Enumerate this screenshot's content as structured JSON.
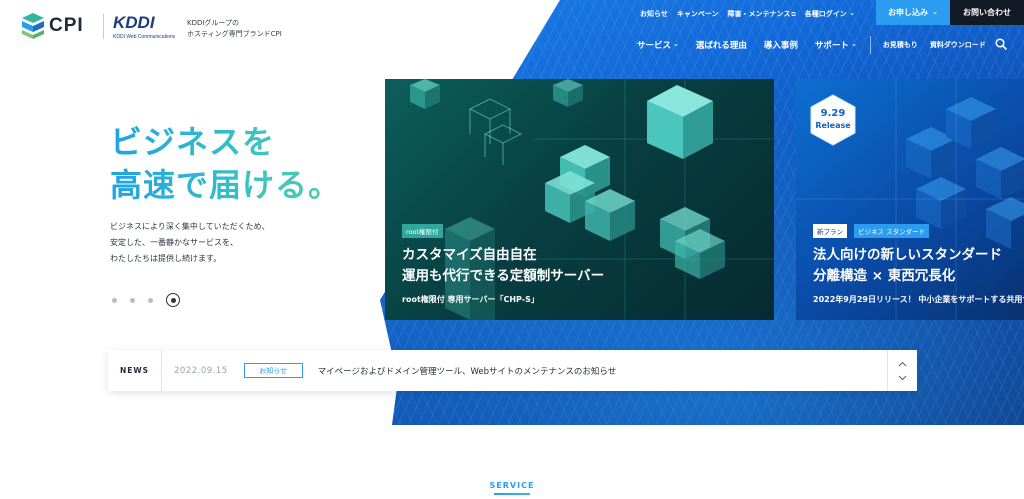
{
  "brand": {
    "cpi_name": "CPI",
    "kddi_name": "KDDI",
    "kddi_sub": "KDDI Web Communications",
    "tagline": [
      "KDDIグループの",
      "ホスティング専門ブランドCPI"
    ]
  },
  "header": {
    "top_links": [
      "お知らせ",
      "キャンペーン",
      "障害・メンテナンス",
      "各種ログイン"
    ],
    "apply_label": "お申し込み",
    "contact_label": "お問い合わせ",
    "main_nav": [
      "サービス",
      "選ばれる理由",
      "導入事例",
      "サポート"
    ],
    "sub_nav": [
      "お見積もり",
      "資料ダウンロード"
    ]
  },
  "hero": {
    "title_line1": "ビジネスを",
    "title_line2": "高速で届ける。",
    "desc_line1": "ビジネスにより深く集中していただくため、",
    "desc_line2": "安定した、一番静かなサービスを、",
    "desc_line3": "わたしたちは提供し続けます。",
    "slide_count": 4,
    "active_slide": 4
  },
  "slides": [
    {
      "tag": "root権限付",
      "title_line1": "カスタマイズ自由自在",
      "title_line2": "運用も代行できる定額制サーバー",
      "subtitle": "root権限付 専用サーバー「CHP-S」"
    },
    {
      "badge_date": "9.29",
      "badge_release": "Release",
      "tags": [
        "新プラン",
        "ビジネス スタンダード"
      ],
      "title_line1": "法人向けの新しいスタンダード",
      "title_line2": "分離構造 × 東西冗長化",
      "subtitle": "2022年9月29日リリース！ 中小企業をサポートする共用サ"
    }
  ],
  "news": {
    "label": "NEWS",
    "date": "2022.09.15",
    "category": "お知らせ",
    "text": "マイページおよびドメイン管理ツール、Webサイトのメンテナンスのお知らせ"
  },
  "service": {
    "heading": "SERVICE"
  },
  "colors": {
    "accent_blue": "#2b9cf0",
    "dark": "#121a26",
    "teal": "#2ea89c"
  }
}
